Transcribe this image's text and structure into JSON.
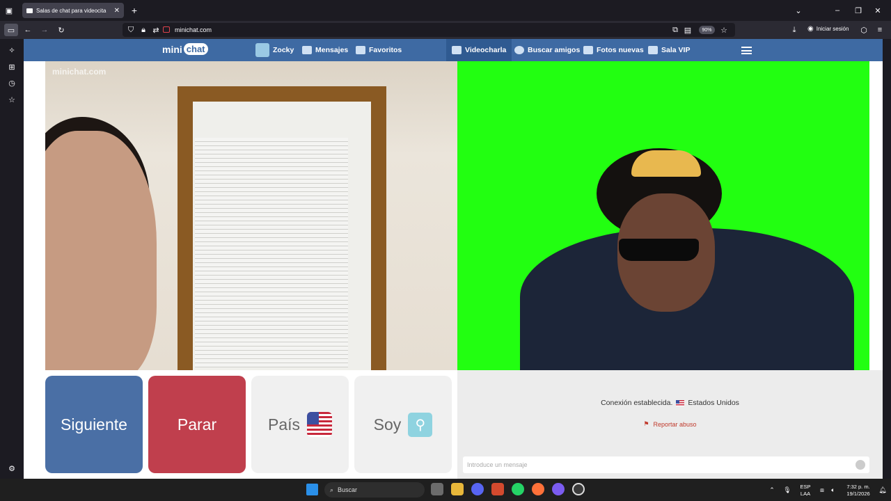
{
  "browser": {
    "tab_title": "Salas de chat para videocita",
    "url": "minichat.com",
    "zoom": "90%",
    "signin": "Iniciar sesión"
  },
  "site": {
    "logo_a": "mini",
    "logo_b": "chat",
    "nav": {
      "user": "Zocky",
      "messages": "Mensajes",
      "favorites": "Favoritos",
      "videochat": "Videocharla",
      "find_friends": "Buscar amigos",
      "new_photos": "Fotos nuevas",
      "vip": "Sala VIP"
    },
    "watermark": "minichat.com"
  },
  "controls": {
    "next": "Siguiente",
    "stop": "Parar",
    "country": "País",
    "soy": "Soy"
  },
  "chat": {
    "status": "Conexión establecida.",
    "country": "Estados Unidos",
    "report": "Reportar abuso",
    "placeholder": "Introduce un mensaje"
  },
  "taskbar": {
    "search": "Buscar",
    "lang_a": "ESP",
    "lang_b": "LAA",
    "time": "7:32 p. m.",
    "date": "19/1/2026"
  },
  "colors": {
    "brand": "#3e6aa3",
    "next": "#4a6fa5",
    "stop": "#c03f4d",
    "greenscreen": "#22ff11"
  }
}
